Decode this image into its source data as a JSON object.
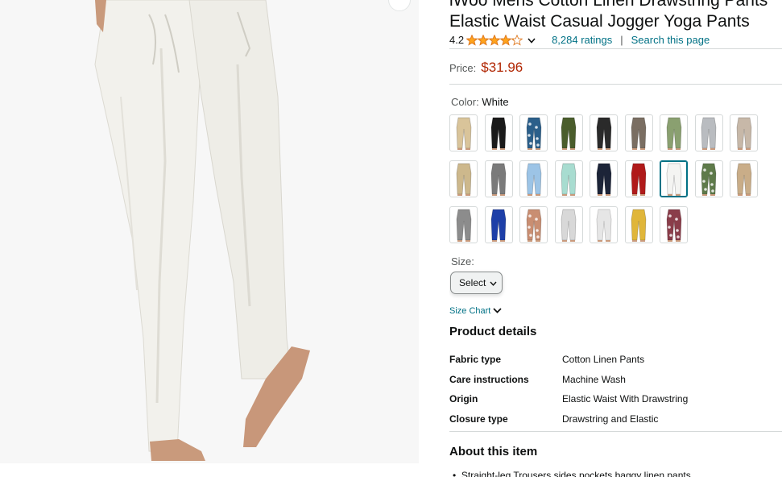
{
  "product": {
    "title_line1": "iWoo Mens Cotton Linen Drawstring Pants",
    "title_line2": "Elastic Waist Casual Jogger Yoga Pants",
    "image_alt_icon": "product-photo-white-linen-pants"
  },
  "rating": {
    "value": "4.2",
    "stars_filled": 4.2,
    "stars_total": 5,
    "count_label": "8,284 ratings",
    "separator": "|",
    "search_label": "Search this page"
  },
  "price": {
    "label": "Price:",
    "value": "$31.96"
  },
  "color": {
    "label": "Color:",
    "selected": "White",
    "swatches": [
      {
        "color": "#d9c49a",
        "selected": false
      },
      {
        "color": "#1a1a1a",
        "selected": false
      },
      {
        "color": "#2b5f8a",
        "selected": false,
        "pattern": "print"
      },
      {
        "color": "#4a5d2c",
        "selected": false
      },
      {
        "color": "#2a2a2a",
        "selected": false
      },
      {
        "color": "#7a6e62",
        "selected": false
      },
      {
        "color": "#8aa070",
        "selected": false
      },
      {
        "color": "#b9bcc0",
        "selected": false
      },
      {
        "color": "#c7b8a8",
        "selected": false
      },
      {
        "color": "#cdb88c",
        "selected": false
      },
      {
        "color": "#7a7a7a",
        "selected": false
      },
      {
        "color": "#9cc4e6",
        "selected": false
      },
      {
        "color": "#a8dcd0",
        "selected": false
      },
      {
        "color": "#1c2438",
        "selected": false
      },
      {
        "color": "#b01a1a",
        "selected": false
      },
      {
        "color": "#f4f4f2",
        "selected": true
      },
      {
        "color": "#5e7a4a",
        "selected": false,
        "pattern": "print"
      },
      {
        "color": "#c9ad88",
        "selected": false
      },
      {
        "color": "#8c8c8c",
        "selected": false
      },
      {
        "color": "#1d3fa8",
        "selected": false
      },
      {
        "color": "#c98e72",
        "selected": false,
        "pattern": "print"
      },
      {
        "color": "#d8d8d8",
        "selected": false
      },
      {
        "color": "#e6e6e6",
        "selected": false
      },
      {
        "color": "#e0b63a",
        "selected": false
      },
      {
        "color": "#8a3d4a",
        "selected": false,
        "pattern": "print"
      }
    ]
  },
  "size": {
    "label": "Size:",
    "select_value": "Select",
    "chart_label": "Size Chart"
  },
  "product_details": {
    "heading": "Product details",
    "rows": [
      {
        "key": "Fabric type",
        "value": "Cotton Linen Pants"
      },
      {
        "key": "Care instructions",
        "value": "Machine Wash"
      },
      {
        "key": "Origin",
        "value": "Elastic Waist With Drawstring"
      },
      {
        "key": "Closure type",
        "value": "Drawstring and Elastic"
      }
    ]
  },
  "about": {
    "heading": "About this item",
    "first_bullet": "Straight-leg Trousers sides pockets baggy linen pants"
  },
  "colors": {
    "price_red": "#b12704",
    "link_teal": "#007185",
    "star_orange": "#ffa41c",
    "text": "#0f1111",
    "muted": "#565959"
  }
}
